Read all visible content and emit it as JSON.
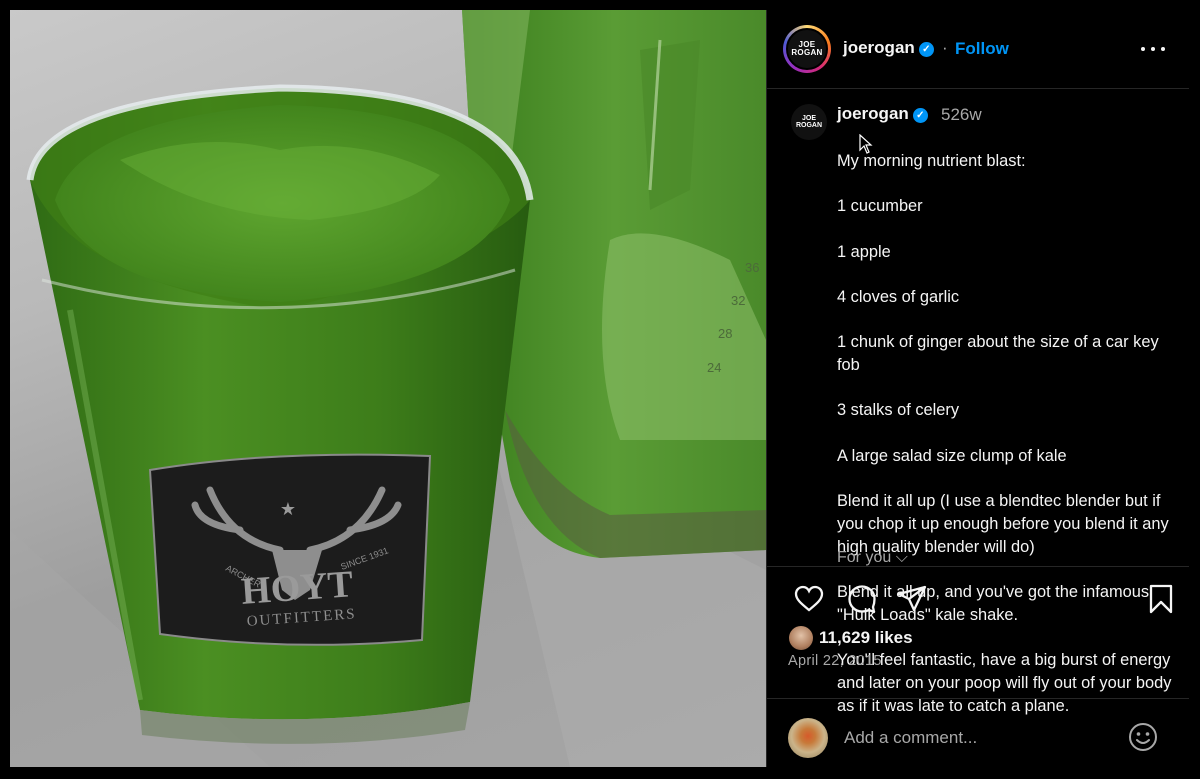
{
  "post": {
    "username": "joerogan",
    "avatar_text": [
      "JOE",
      "ROGAN"
    ],
    "follow_label": "Follow",
    "separator": "·",
    "verified_mark": "✓",
    "time_ago": "526w",
    "caption_lines": [
      "My morning nutrient blast:",
      "1 cucumber",
      "1 apple",
      "4 cloves of garlic",
      "1 chunk of ginger about the size of a car key fob",
      "3 stalks of celery",
      "A large salad size clump of kale",
      "Blend it all up (I use a blendtec blender but if you chop it up enough before you blend it any high quality blender will do)",
      "Blend it all up, and you've got the infamous \"Hulk Loads\" kale shake.",
      "You'll feel fantastic, have a big burst of energy and later on your poop will fly out of your body as if it was late to catch a plane."
    ],
    "for_you_label": "For you",
    "likes": "11,629 likes",
    "date": "April 22, 2015",
    "comment_placeholder": "Add a comment..."
  },
  "photo": {
    "glass_brand": "HOYT",
    "glass_subtext": "OUTFITTERS",
    "glass_left_arc": "ARCHERY",
    "glass_right_arc": "SINCE 1931",
    "blender_marks": [
      "36",
      "32",
      "28",
      "24"
    ]
  },
  "icons": {
    "more": "more-options-icon",
    "like": "heart-icon",
    "comment": "comment-icon",
    "share": "share-icon",
    "save": "bookmark-icon",
    "emoji": "emoji-icon",
    "chevron": "chevron-down-icon"
  },
  "colors": {
    "accent": "#0095f6",
    "background": "#000000",
    "muted_text": "#a8a8a8",
    "smoothie_green": "#3f8a1c"
  }
}
